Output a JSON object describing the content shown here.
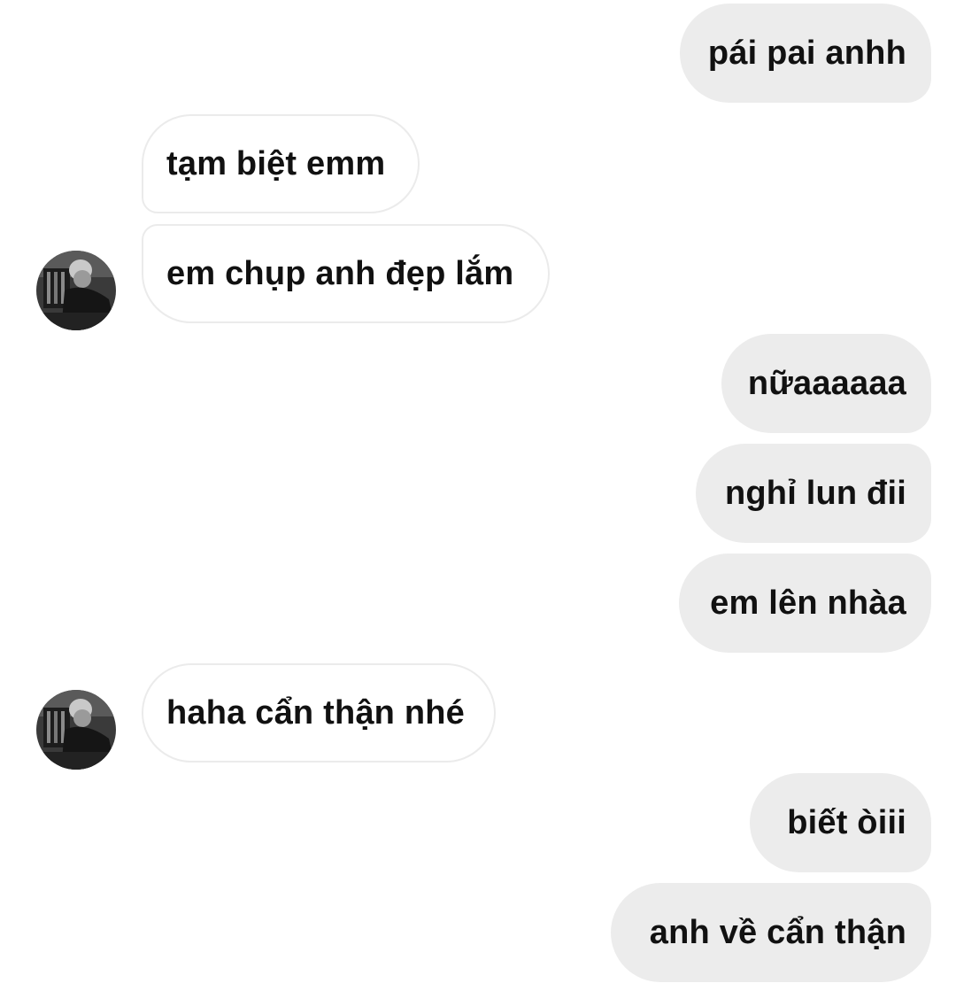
{
  "messages": [
    {
      "side": "sent",
      "text": "pái pai anhh"
    },
    {
      "side": "received",
      "text": "tạm biệt emm"
    },
    {
      "side": "received",
      "text": "em chụp anh đẹp lắm"
    },
    {
      "side": "sent",
      "text": "nữaaaaaa"
    },
    {
      "side": "sent",
      "text": "nghỉ lun đii"
    },
    {
      "side": "sent",
      "text": "em lên nhàa"
    },
    {
      "side": "received",
      "text": "haha cẩn thận nhé"
    },
    {
      "side": "sent",
      "text": "biết òiii"
    },
    {
      "side": "sent",
      "text": "anh về cẩn thận"
    }
  ],
  "colors": {
    "sent_bubble": "#ececec",
    "received_bubble": "#ffffff",
    "received_border": "#ebebeb",
    "text": "#111111"
  }
}
